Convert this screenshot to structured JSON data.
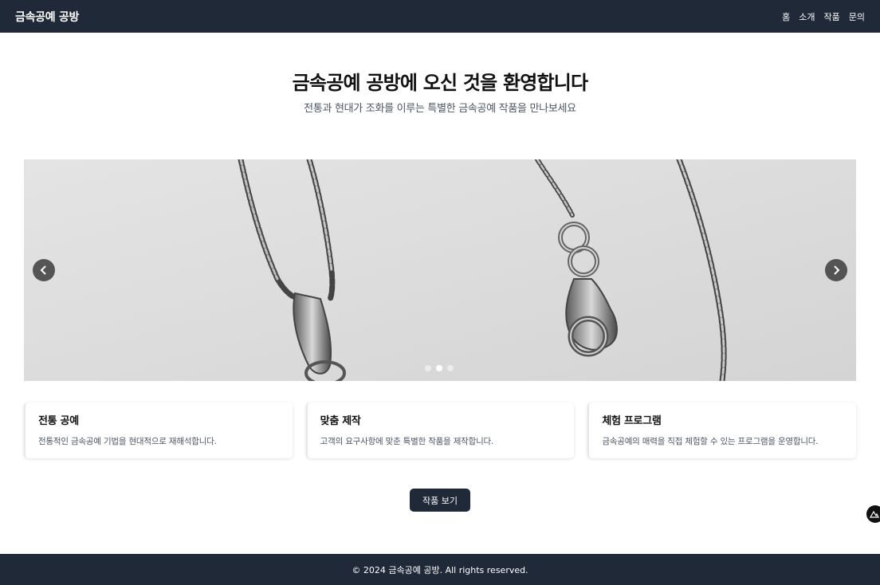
{
  "nav": {
    "brand": "금속공예 공방",
    "links": [
      "홈",
      "소개",
      "작품",
      "문의"
    ]
  },
  "hero": {
    "title": "금속공예 공방에 오신 것을 환영합니다",
    "subtitle": "전통과 현대가 조화를 이루는 특별한 금속공예 작품을 만나보세요"
  },
  "carousel": {
    "image_subject": "silver-chain-necklace-photo",
    "slide_count": 3,
    "active_slide": 2,
    "prev_icon": "chevron-left-icon",
    "next_icon": "chevron-right-icon"
  },
  "cards": [
    {
      "title": "전통 공예",
      "description": "전통적인 금속공예 기법을 현대적으로 재해석합니다."
    },
    {
      "title": "맞춤 제작",
      "description": "고객의 요구사항에 맞춘 특별한 작품을 제작합니다."
    },
    {
      "title": "체험 프로그램",
      "description": "금속공예의 매력을 직접 체험할 수 있는 프로그램을 운영합니다."
    }
  ],
  "cta": {
    "label": "작품 보기"
  },
  "footer": {
    "text": "© 2024 금속공예 공방. All rights reserved."
  },
  "colors": {
    "nav_bg": "#1f2937",
    "page_bg": "#ffffff",
    "text_primary": "#111111",
    "text_secondary": "#4b5563"
  }
}
